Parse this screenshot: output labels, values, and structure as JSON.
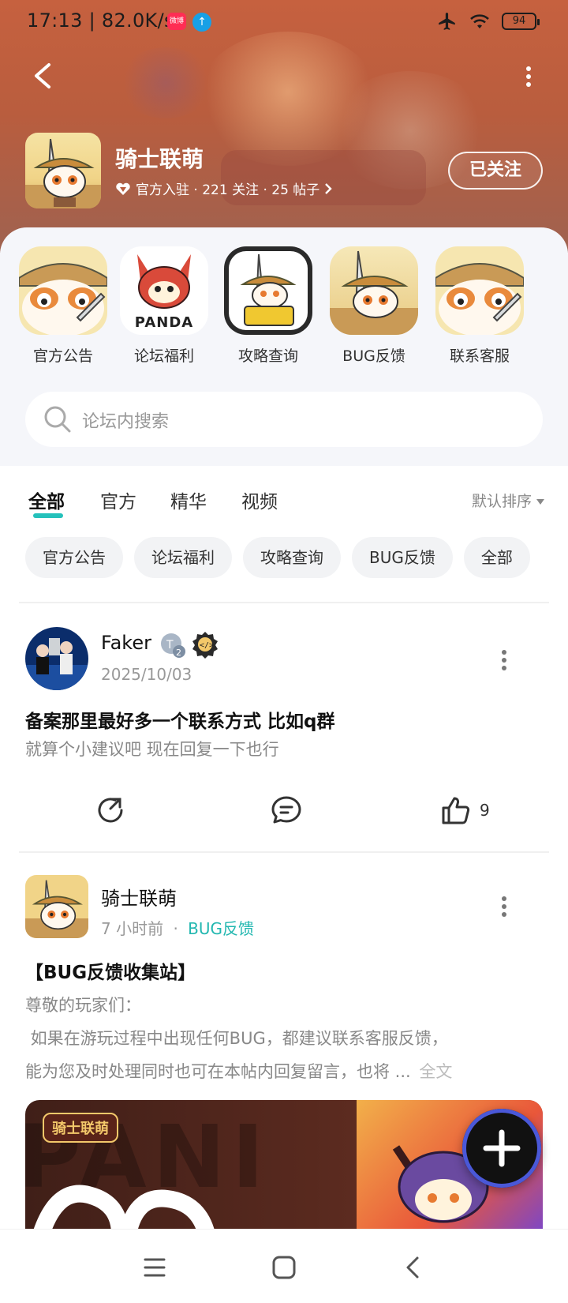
{
  "status": {
    "time_speed": "17:13 | 82.0K/s",
    "badge_text": "微博",
    "battery": "94"
  },
  "forum": {
    "name": "骑士联萌",
    "meta": "官方入驻 · 221 关注 · 25 帖子",
    "follow_label": "已关注"
  },
  "quick_links": [
    {
      "label": "官方公告",
      "icon": "panda-knight-face"
    },
    {
      "label": "论坛福利",
      "icon": "panda-dragon",
      "icon_text": "PANDA"
    },
    {
      "label": "攻略查询",
      "icon": "panda-boss-guide"
    },
    {
      "label": "BUG反馈",
      "icon": "panda-knight-sword"
    },
    {
      "label": "联系客服",
      "icon": "panda-knight-face"
    }
  ],
  "search": {
    "placeholder": "论坛内搜索"
  },
  "tabs": [
    "全部",
    "官方",
    "精华",
    "视频"
  ],
  "sort_label": "默认排序",
  "chips": [
    "官方公告",
    "论坛福利",
    "攻略查询",
    "BUG反馈",
    "全部"
  ],
  "posts": [
    {
      "author": "Faker",
      "date": "2025/10/03",
      "title": "备案那里最好多一个联系方式 比如q群",
      "body": "就算个小建议吧 现在回复一下也行",
      "likes": "9"
    },
    {
      "author": "骑士联萌",
      "time": "7 小时前",
      "separator": "·",
      "tag": "BUG反馈",
      "title": "【BUG反馈收集站】",
      "body_line1": "尊敬的玩家们：",
      "body_line2": " 如果在游玩过程中出现任何BUG，都建议联系客服反馈，",
      "body_line3": "能为您及时处理同时也可在本帖内回复留言，也将 ...",
      "more": "全文",
      "cover_badge": "骑士联萌"
    }
  ],
  "colors": {
    "accent": "#25c1bb",
    "tag": "#22b7b0",
    "header": "#c6613f"
  }
}
